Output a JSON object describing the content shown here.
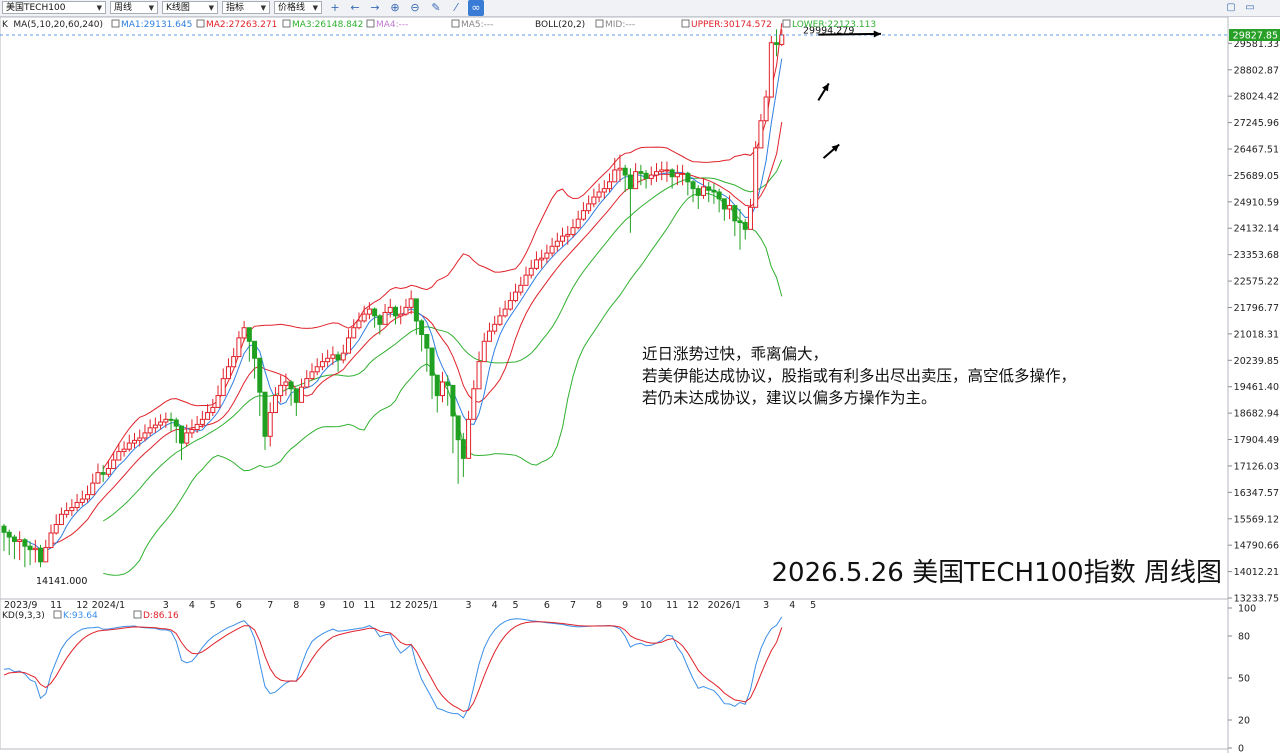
{
  "toolbar": {
    "symbol": "美国TECH100",
    "period": "周线",
    "chart_type": "K线图",
    "indicator": "指标",
    "price_line": "价格线",
    "icons": [
      "crosshair-icon",
      "arrow-left-icon",
      "arrow-right-icon",
      "zoom-in-icon",
      "zoom-out-icon",
      "draw-icon",
      "link-icon"
    ],
    "window_icons": [
      "restore-icon",
      "maximize-icon"
    ]
  },
  "legend": {
    "k": "K",
    "ma_label": "MA(5,10,20,60,240)",
    "ma1": "MA1:29131.645",
    "ma2": "MA2:27263.271",
    "ma3": "MA3:26148.842",
    "ma4": "MA4:---",
    "ma5": "MA5:---",
    "boll": "BOLL(20,2)",
    "mid": "MID:---",
    "upper": "UPPER:30174.572",
    "lower": "LOWER:22123.113",
    "kd_label": "KD(9,3,3)",
    "kd_k": "K:93.64",
    "kd_d": "D:86.16"
  },
  "colors": {
    "up": "#e0222a",
    "down": "#20a020",
    "ma1": "#2f7fe0",
    "ma2": "#e0222a",
    "ma3": "#30b030",
    "boll": "#e0222a",
    "kd_k": "#3b8fe8",
    "kd_d": "#e0222a",
    "last_price_bg": "#28a028"
  },
  "annotations": {
    "high_label": "29994.279",
    "low_label": "14141.000",
    "last_price": "29827.85",
    "note_lines": [
      "近日涨势过快，乖离偏大，",
      "若美伊能达成协议，股指或有利多出尽出卖压，高空低多操作，",
      "若仍未达成协议，建议以偏多方操作为主。"
    ],
    "title": "2026.5.26 美国TECH100指数 周线图"
  },
  "chart_data": {
    "type": "candlestick",
    "period": "weekly",
    "x_labels": [
      "2023/9",
      "11",
      "12",
      "2024/1",
      "3",
      "4",
      "5",
      "6",
      "7",
      "8",
      "9",
      "10",
      "11",
      "12",
      "2025/1",
      "3",
      "4",
      "5",
      "6",
      "7",
      "8",
      "9",
      "10",
      "11",
      "12",
      "2026/1",
      "3",
      "4",
      "5"
    ],
    "x_label_weeks": [
      0,
      10,
      15,
      20,
      31,
      36,
      40,
      45,
      51,
      56,
      61,
      66,
      70,
      75,
      80,
      89,
      94,
      98,
      104,
      109,
      114,
      119,
      123,
      128,
      132,
      138,
      146,
      151,
      155
    ],
    "y_ticks": [
      "29581.33",
      "28802.87",
      "28024.42",
      "27245.96",
      "26467.51",
      "25689.05",
      "24910.59",
      "24132.14",
      "23353.68",
      "22575.22",
      "21796.77",
      "21018.31",
      "20239.85",
      "19461.40",
      "18682.94",
      "17904.49",
      "17126.03",
      "16347.57",
      "15569.12",
      "14790.66",
      "14012.21",
      "13233.75"
    ],
    "ylim": [
      13233.75,
      29827.85
    ],
    "kd_ticks": [
      "100",
      "80",
      "50",
      "20",
      "0"
    ],
    "kd_ylim": [
      0,
      100
    ],
    "closes": [
      15170,
      15030,
      14900,
      14950,
      14760,
      14660,
      14700,
      14300,
      14720,
      15150,
      15400,
      15700,
      15810,
      15900,
      16050,
      16150,
      16280,
      16620,
      16930,
      16880,
      17050,
      17300,
      17550,
      17620,
      17800,
      17880,
      17950,
      18100,
      18250,
      18330,
      18420,
      18500,
      18480,
      18300,
      17800,
      18100,
      18200,
      18350,
      18500,
      18700,
      18850,
      19200,
      19700,
      20050,
      20350,
      20900,
      21200,
      20800,
      20300,
      19300,
      18000,
      18700,
      19200,
      19500,
      19600,
      19400,
      19000,
      19450,
      19700,
      19900,
      20050,
      20200,
      20300,
      20400,
      20250,
      20450,
      20900,
      21200,
      21400,
      21600,
      21750,
      21550,
      21300,
      21650,
      21800,
      21550,
      21600,
      21800,
      22050,
      21400,
      21000,
      20600,
      19800,
      19200,
      19600,
      19500,
      18600,
      17900,
      17350,
      18500,
      19400,
      20200,
      20800,
      21100,
      21300,
      21550,
      21750,
      22000,
      22250,
      22450,
      22750,
      22950,
      23200,
      23250,
      23400,
      23600,
      23750,
      23900,
      23950,
      24150,
      24400,
      24650,
      24850,
      25050,
      25200,
      25300,
      25500,
      25850,
      25900,
      25700,
      25300,
      25800,
      25750,
      25600,
      25700,
      25800,
      25850,
      25850,
      25650,
      25750,
      25750,
      25500,
      25300,
      25100,
      25350,
      25250,
      25200,
      25000,
      24700,
      24800,
      24350,
      24300,
      24100,
      24750,
      26500,
      27300,
      28000,
      29600,
      29550,
      29827.85
    ],
    "lows": [
      14620,
      14500,
      14380,
      14350,
      14141,
      14200,
      14280,
      14141,
      14400,
      14850,
      15100,
      15450,
      15600,
      15650,
      15800,
      15950,
      16050,
      16350,
      16600,
      16650,
      16800,
      17100,
      17350,
      17400,
      17550,
      17650,
      17700,
      17850,
      18000,
      18100,
      18200,
      18250,
      18150,
      17800,
      17300,
      17700,
      17950,
      18100,
      18250,
      18500,
      18600,
      18900,
      19450,
      19800,
      20100,
      20600,
      20800,
      20200,
      19700,
      18600,
      17600,
      17700,
      18700,
      19000,
      19200,
      18900,
      18600,
      19100,
      19450,
      19650,
      19800,
      19950,
      20050,
      20100,
      19900,
      20150,
      20600,
      20900,
      21150,
      21350,
      21450,
      21200,
      21000,
      21400,
      21500,
      21300,
      21300,
      21550,
      21600,
      21000,
      20500,
      19900,
      19100,
      18700,
      19000,
      18900,
      17500,
      16600,
      16800,
      17600,
      18700,
      19700,
      20400,
      20800,
      21000,
      21250,
      21500,
      21700,
      21950,
      22150,
      22450,
      22650,
      22900,
      22950,
      23100,
      23300,
      23450,
      23600,
      23650,
      23850,
      24100,
      24350,
      24550,
      24750,
      24900,
      25000,
      25200,
      25550,
      25500,
      25200,
      24000,
      25300,
      25400,
      25300,
      25400,
      25500,
      25550,
      25500,
      25300,
      25400,
      25400,
      25100,
      24900,
      24700,
      25000,
      24900,
      24850,
      24600,
      24350,
      24400,
      23900,
      23500,
      23800,
      24200,
      25700,
      26800,
      27600,
      28700,
      29200,
      29500
    ],
    "highs": [
      15420,
      15250,
      15100,
      15200,
      15000,
      14900,
      14950,
      14800,
      14950,
      15400,
      15700,
      15900,
      16050,
      16150,
      16300,
      16400,
      16550,
      16900,
      17200,
      17150,
      17300,
      17550,
      17800,
      17850,
      18050,
      18100,
      18200,
      18350,
      18500,
      18550,
      18650,
      18700,
      18700,
      18550,
      18300,
      18350,
      18500,
      18600,
      18750,
      18950,
      19100,
      19500,
      20000,
      20300,
      20600,
      21100,
      21400,
      21100,
      20600,
      19700,
      18600,
      19000,
      19450,
      19800,
      19850,
      19650,
      19400,
      19700,
      19950,
      20150,
      20300,
      20450,
      20550,
      20650,
      20500,
      20700,
      21150,
      21450,
      21650,
      21850,
      21950,
      21800,
      21600,
      21900,
      22050,
      21850,
      21850,
      22050,
      22300,
      22000,
      21450,
      21000,
      20400,
      19700,
      19900,
      19800,
      19000,
      18600,
      18100,
      18750,
      19650,
      20500,
      21050,
      21350,
      21550,
      21800,
      22000,
      22250,
      22500,
      22700,
      23000,
      23200,
      23450,
      23500,
      23650,
      23850,
      24000,
      24150,
      24200,
      24400,
      24650,
      24900,
      25100,
      25300,
      25450,
      25550,
      25750,
      26200,
      26300,
      26000,
      25900,
      26050,
      26000,
      25850,
      25950,
      26050,
      26100,
      26100,
      25900,
      26000,
      26000,
      25800,
      25550,
      25400,
      25600,
      25500,
      25450,
      25300,
      25000,
      25100,
      24700,
      24700,
      24400,
      25000,
      26700,
      27500,
      28200,
      29800,
      29994.279,
      29994.279
    ],
    "bull_upper_end": 30174.572,
    "bull_lower_end": 22123.113,
    "ma1_end": 29131.645,
    "ma2_end": 27263.271,
    "ma3_end": 26148.842,
    "kd_k_end": 93.64,
    "kd_d_end": 86.16,
    "arrows": [
      {
        "from": [
          156,
          29840
        ],
        "to": [
          168,
          29860
        ]
      },
      {
        "from": [
          156,
          27900
        ],
        "to": [
          158,
          28400
        ]
      },
      {
        "from": [
          157,
          26200
        ],
        "to": [
          160,
          26600
        ]
      }
    ]
  }
}
